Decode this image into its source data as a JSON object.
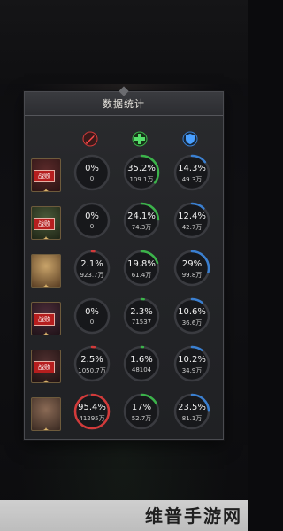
{
  "panel": {
    "title": "数据统计"
  },
  "columns": [
    {
      "icon": "sword-icon",
      "color": "#d23a3a"
    },
    {
      "icon": "heal-icon",
      "color": "#3bb34a"
    },
    {
      "icon": "shield-icon",
      "color": "#3a7fd0"
    }
  ],
  "rows": [
    {
      "badge": "战败",
      "stats": [
        {
          "pct": "0%",
          "val": "0",
          "fill": 0.0
        },
        {
          "pct": "35.2%",
          "val": "109.1万",
          "fill": 0.352
        },
        {
          "pct": "14.3%",
          "val": "49.3万",
          "fill": 0.143
        }
      ]
    },
    {
      "badge": "战败",
      "stats": [
        {
          "pct": "0%",
          "val": "0",
          "fill": 0.0
        },
        {
          "pct": "24.1%",
          "val": "74.3万",
          "fill": 0.241
        },
        {
          "pct": "12.4%",
          "val": "42.7万",
          "fill": 0.124
        }
      ]
    },
    {
      "badge": "",
      "stats": [
        {
          "pct": "2.1%",
          "val": "923.7万",
          "fill": 0.021
        },
        {
          "pct": "19.8%",
          "val": "61.4万",
          "fill": 0.198
        },
        {
          "pct": "29%",
          "val": "99.8万",
          "fill": 0.29
        }
      ]
    },
    {
      "badge": "战败",
      "stats": [
        {
          "pct": "0%",
          "val": "0",
          "fill": 0.0
        },
        {
          "pct": "2.3%",
          "val": "71537",
          "fill": 0.023
        },
        {
          "pct": "10.6%",
          "val": "36.6万",
          "fill": 0.106
        }
      ]
    },
    {
      "badge": "战败",
      "stats": [
        {
          "pct": "2.5%",
          "val": "1050.7万",
          "fill": 0.025
        },
        {
          "pct": "1.6%",
          "val": "48104",
          "fill": 0.016
        },
        {
          "pct": "10.2%",
          "val": "34.9万",
          "fill": 0.102
        }
      ]
    },
    {
      "badge": "",
      "stats": [
        {
          "pct": "95.4%",
          "val": "41295万",
          "fill": 0.954
        },
        {
          "pct": "17%",
          "val": "52.7万",
          "fill": 0.17
        },
        {
          "pct": "23.5%",
          "val": "81.1万",
          "fill": 0.235
        }
      ]
    }
  ],
  "watermark": "维普手游网"
}
